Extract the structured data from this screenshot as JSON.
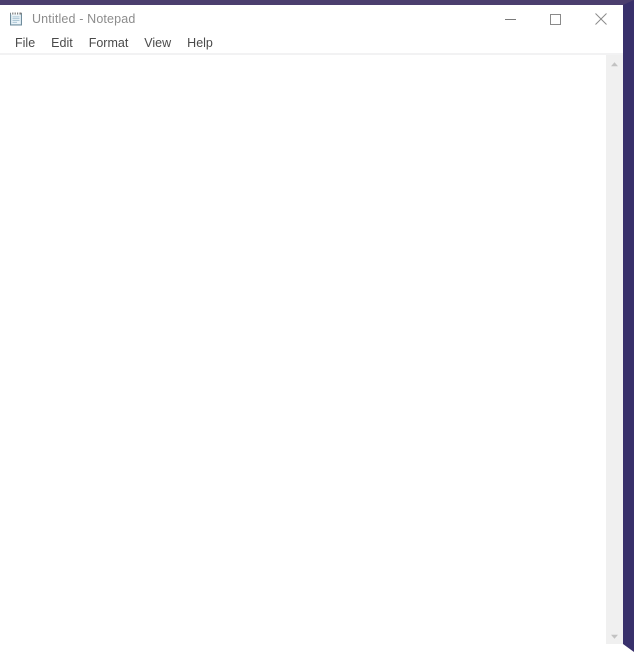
{
  "window": {
    "title": "Untitled - Notepad",
    "icon": "notepad-icon",
    "border_color": "#4b3e6e",
    "border_color_right": "#38306b",
    "titlebar_bg": "#ffffff",
    "title_color": "#8c8c8c"
  },
  "window_controls": {
    "minimize": {
      "label": "Minimize",
      "icon": "minimize-icon"
    },
    "maximize": {
      "label": "Maximize",
      "icon": "maximize-icon"
    },
    "close": {
      "label": "Close",
      "icon": "close-icon"
    }
  },
  "menubar": {
    "items": [
      {
        "label": "File"
      },
      {
        "label": "Edit"
      },
      {
        "label": "Format"
      },
      {
        "label": "View"
      },
      {
        "label": "Help"
      }
    ]
  },
  "editor": {
    "content": "",
    "placeholder": "",
    "background": "#ffffff",
    "text_color": "#000000"
  },
  "scrollbar": {
    "orientation": "vertical",
    "track_color": "#f0f0f0",
    "arrow_color": "#c2c2c2",
    "up_icon": "chevron-up-icon",
    "down_icon": "chevron-down-icon",
    "thumb_visible": false
  }
}
